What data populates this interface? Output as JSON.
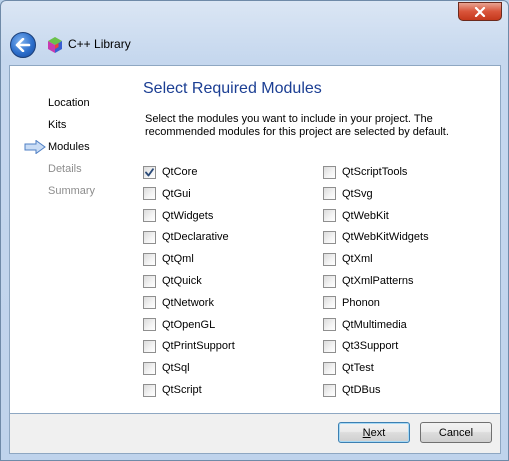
{
  "window": {
    "title": "C++ Library"
  },
  "nav": {
    "items": [
      {
        "label": "Location",
        "state": "done"
      },
      {
        "label": "Kits",
        "state": "done"
      },
      {
        "label": "Modules",
        "state": "current"
      },
      {
        "label": "Details",
        "state": "disabled"
      },
      {
        "label": "Summary",
        "state": "disabled"
      }
    ]
  },
  "page": {
    "heading": "Select Required Modules",
    "description": "Select the modules you want to include in your project. The recommended modules for this project are selected by default."
  },
  "modules": {
    "left": [
      {
        "label": "QtCore",
        "checked": true
      },
      {
        "label": "QtGui",
        "checked": false
      },
      {
        "label": "QtWidgets",
        "checked": false
      },
      {
        "label": "QtDeclarative",
        "checked": false
      },
      {
        "label": "QtQml",
        "checked": false
      },
      {
        "label": "QtQuick",
        "checked": false
      },
      {
        "label": "QtNetwork",
        "checked": false
      },
      {
        "label": "QtOpenGL",
        "checked": false
      },
      {
        "label": "QtPrintSupport",
        "checked": false
      },
      {
        "label": "QtSql",
        "checked": false
      },
      {
        "label": "QtScript",
        "checked": false
      }
    ],
    "right": [
      {
        "label": "QtScriptTools",
        "checked": false
      },
      {
        "label": "QtSvg",
        "checked": false
      },
      {
        "label": "QtWebKit",
        "checked": false
      },
      {
        "label": "QtWebKitWidgets",
        "checked": false
      },
      {
        "label": "QtXml",
        "checked": false
      },
      {
        "label": "QtXmlPatterns",
        "checked": false
      },
      {
        "label": "Phonon",
        "checked": false
      },
      {
        "label": "QtMultimedia",
        "checked": false
      },
      {
        "label": "Qt3Support",
        "checked": false
      },
      {
        "label": "QtTest",
        "checked": false
      },
      {
        "label": "QtDBus",
        "checked": false
      }
    ]
  },
  "buttons": {
    "next": {
      "accel": "N",
      "rest": "ext"
    },
    "cancel": {
      "label": "Cancel"
    }
  },
  "colors": {
    "heading": "#1b3e93",
    "accent": "#3c7fb1",
    "close": "#c4381c"
  }
}
